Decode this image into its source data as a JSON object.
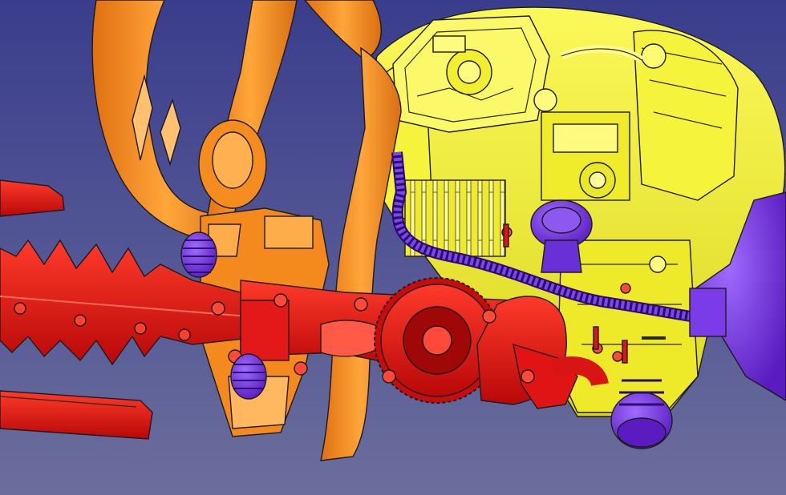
{
  "scene": {
    "background_top": "#3a3d8c",
    "background_bottom": "#6b6e9c",
    "parts": [
      {
        "name": "frame-handle",
        "color": "#f08a1c"
      },
      {
        "name": "engine",
        "color": "#f4f12e"
      },
      {
        "name": "hedge-blade",
        "color": "#e01010"
      },
      {
        "name": "anti-vibration-spring",
        "color": "#7a2ee0"
      },
      {
        "name": "fuel-hose",
        "color": "#5522c8"
      },
      {
        "name": "gear-housing",
        "color": "#d81414"
      },
      {
        "name": "blade-guard",
        "color": "#d41010"
      }
    ]
  }
}
